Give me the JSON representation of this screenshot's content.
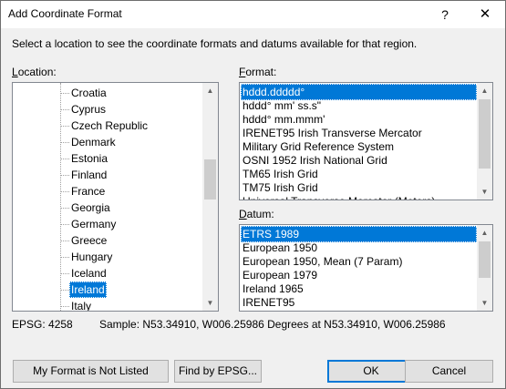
{
  "window": {
    "title": "Add Coordinate Format",
    "help_label": "?",
    "close_label": "✕"
  },
  "instructions": "Select a location to see the coordinate formats and datums available for that region.",
  "location": {
    "label_underlined": "L",
    "label_rest": "ocation:",
    "items": [
      "Croatia",
      "Cyprus",
      "Czech Republic",
      "Denmark",
      "Estonia",
      "Finland",
      "France",
      "Georgia",
      "Germany",
      "Greece",
      "Hungary",
      "Iceland",
      "Ireland",
      "Italy"
    ],
    "selected": "Ireland"
  },
  "format": {
    "label_underlined": "F",
    "label_rest": "ormat:",
    "items": [
      "hddd.ddddd°",
      "hddd° mm' ss.s\"",
      "hddd° mm.mmm'",
      "IRENET95 Irish Transverse Mercator",
      "Military Grid Reference System",
      "OSNI 1952 Irish National Grid",
      "TM65 Irish Grid",
      "TM75 Irish Grid",
      "Universal Transverse Mercator (Meters)"
    ],
    "selected": "hddd.ddddd°"
  },
  "datum": {
    "label_underlined": "D",
    "label_rest": "atum:",
    "items": [
      "ETRS 1989",
      "European 1950",
      "European 1950, Mean (7 Param)",
      "European 1979",
      "Ireland 1965",
      "IRENET95"
    ],
    "selected": "ETRS 1989"
  },
  "status": {
    "epsg": "EPSG: 4258",
    "sample": "Sample: N53.34910, W006.25986 Degrees at N53.34910, W006.25986"
  },
  "buttons": {
    "not_listed": "My Format is Not Listed",
    "find_epsg": "Find by EPSG...",
    "ok": "OK",
    "cancel": "Cancel"
  },
  "icons": {
    "scroll_up": "▲",
    "scroll_down": "▼"
  }
}
